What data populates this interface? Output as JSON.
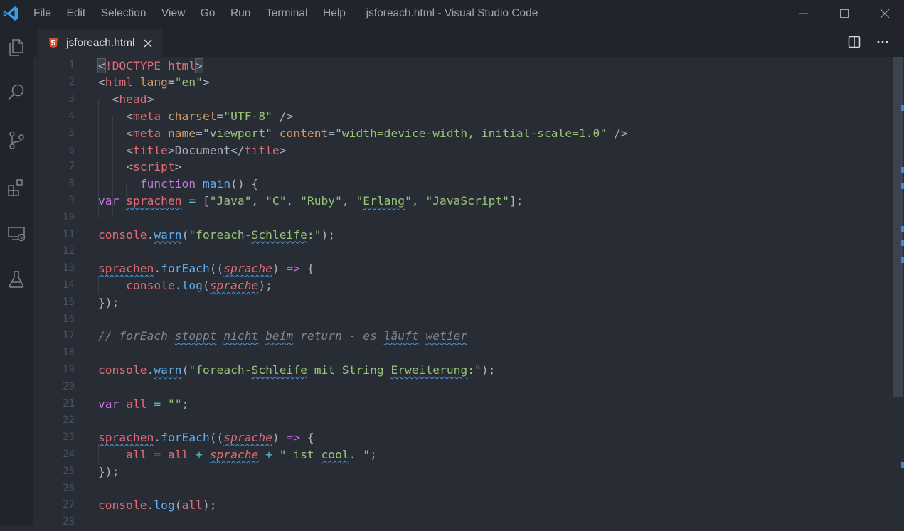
{
  "titlebar": {
    "menu": [
      "File",
      "Edit",
      "Selection",
      "View",
      "Go",
      "Run",
      "Terminal",
      "Help"
    ],
    "window_title": "jsforeach.html - Visual Studio Code"
  },
  "activity_bar": {
    "icons": [
      "explorer-icon",
      "search-icon",
      "source-control-icon",
      "extensions-icon",
      "remote-explorer-icon",
      "testing-icon"
    ]
  },
  "tabs": [
    {
      "label": "jsforeach.html",
      "icon": "html5-icon",
      "active": true
    }
  ],
  "editor": {
    "lines": [
      {
        "n": "1",
        "tokens": [
          [
            "bracket",
            "<"
          ],
          [
            "tag",
            "!DOCTYPE"
          ],
          [
            "plain",
            " "
          ],
          [
            "tag",
            "html"
          ],
          [
            "bracket",
            ">"
          ]
        ]
      },
      {
        "n": "2",
        "tokens": [
          [
            "punc",
            "<"
          ],
          [
            "tag",
            "html"
          ],
          [
            "plain",
            " "
          ],
          [
            "attr",
            "lang"
          ],
          [
            "punc",
            "="
          ],
          [
            "str",
            "\"en\""
          ],
          [
            "punc",
            ">"
          ]
        ]
      },
      {
        "n": "3",
        "tokens": [
          [
            "plain",
            "  "
          ],
          [
            "punc",
            "<"
          ],
          [
            "tag",
            "head"
          ],
          [
            "punc",
            ">"
          ]
        ]
      },
      {
        "n": "4",
        "tokens": [
          [
            "plain",
            "    "
          ],
          [
            "punc",
            "<"
          ],
          [
            "tag",
            "meta"
          ],
          [
            "plain",
            " "
          ],
          [
            "attr",
            "charset"
          ],
          [
            "punc",
            "="
          ],
          [
            "str",
            "\"UTF-8\""
          ],
          [
            "plain",
            " "
          ],
          [
            "punc",
            "/>"
          ]
        ]
      },
      {
        "n": "5",
        "tokens": [
          [
            "plain",
            "    "
          ],
          [
            "punc",
            "<"
          ],
          [
            "tag",
            "meta"
          ],
          [
            "plain",
            " "
          ],
          [
            "attr",
            "name"
          ],
          [
            "punc",
            "="
          ],
          [
            "str",
            "\"viewport\""
          ],
          [
            "plain",
            " "
          ],
          [
            "attr",
            "content"
          ],
          [
            "punc",
            "="
          ],
          [
            "str",
            "\"width=device-width, initial-scale=1.0\""
          ],
          [
            "plain",
            " "
          ],
          [
            "punc",
            "/>"
          ]
        ]
      },
      {
        "n": "6",
        "tokens": [
          [
            "plain",
            "    "
          ],
          [
            "punc",
            "<"
          ],
          [
            "tag",
            "title"
          ],
          [
            "punc",
            ">"
          ],
          [
            "plain",
            "Document"
          ],
          [
            "punc",
            "</"
          ],
          [
            "tag",
            "title"
          ],
          [
            "punc",
            ">"
          ]
        ]
      },
      {
        "n": "7",
        "tokens": [
          [
            "plain",
            "    "
          ],
          [
            "punc",
            "<"
          ],
          [
            "tag",
            "script"
          ],
          [
            "punc",
            ">"
          ]
        ]
      },
      {
        "n": "8",
        "tokens": [
          [
            "plain",
            "      "
          ],
          [
            "kw",
            "function"
          ],
          [
            "plain",
            " "
          ],
          [
            "fn",
            "main"
          ],
          [
            "punc",
            "() {"
          ]
        ]
      },
      {
        "n": "9",
        "tokens": [
          [
            "kw",
            "var"
          ],
          [
            "plain",
            " "
          ],
          [
            "var_sq",
            "sprachen"
          ],
          [
            "plain",
            " "
          ],
          [
            "cyan",
            "="
          ],
          [
            "plain",
            " "
          ],
          [
            "punc",
            "["
          ],
          [
            "str",
            "\"Java\""
          ],
          [
            "punc",
            ", "
          ],
          [
            "str",
            "\"C\""
          ],
          [
            "punc",
            ", "
          ],
          [
            "str",
            "\"Ruby\""
          ],
          [
            "punc",
            ", "
          ],
          [
            "str",
            "\""
          ],
          [
            "str_sq",
            "Erlang"
          ],
          [
            "str",
            "\""
          ],
          [
            "punc",
            ", "
          ],
          [
            "str",
            "\"JavaScript\""
          ],
          [
            "punc",
            "];"
          ]
        ]
      },
      {
        "n": "10",
        "tokens": []
      },
      {
        "n": "11",
        "tokens": [
          [
            "var",
            "console"
          ],
          [
            "punc",
            "."
          ],
          [
            "fn_sq",
            "warn"
          ],
          [
            "punc",
            "("
          ],
          [
            "str",
            "\"foreach-"
          ],
          [
            "str_sq",
            "Schleife"
          ],
          [
            "str",
            ":\""
          ],
          [
            "punc",
            ");"
          ]
        ]
      },
      {
        "n": "12",
        "tokens": []
      },
      {
        "n": "13",
        "tokens": [
          [
            "var_sq",
            "sprachen"
          ],
          [
            "punc",
            "."
          ],
          [
            "fn",
            "forEach"
          ],
          [
            "punc",
            "(("
          ],
          [
            "ital_sq",
            "sprache"
          ],
          [
            "punc",
            ") "
          ],
          [
            "kw",
            "=>"
          ],
          [
            "punc",
            " {"
          ]
        ]
      },
      {
        "n": "14",
        "tokens": [
          [
            "plain",
            "    "
          ],
          [
            "var",
            "console"
          ],
          [
            "punc",
            "."
          ],
          [
            "fn",
            "log"
          ],
          [
            "punc",
            "("
          ],
          [
            "ital_sq",
            "sprache"
          ],
          [
            "punc",
            ");"
          ]
        ]
      },
      {
        "n": "15",
        "tokens": [
          [
            "punc",
            "});"
          ]
        ]
      },
      {
        "n": "16",
        "tokens": []
      },
      {
        "n": "17",
        "tokens": [
          [
            "comment",
            "// forEach "
          ],
          [
            "comment_sq",
            "stoppt"
          ],
          [
            "comment",
            " "
          ],
          [
            "comment_sq",
            "nicht"
          ],
          [
            "comment",
            " "
          ],
          [
            "comment_sq",
            "beim"
          ],
          [
            "comment",
            " return - es "
          ],
          [
            "comment_sq",
            "läuft"
          ],
          [
            "comment",
            " "
          ],
          [
            "comment_sq",
            "wetier"
          ]
        ]
      },
      {
        "n": "18",
        "tokens": []
      },
      {
        "n": "19",
        "tokens": [
          [
            "var",
            "console"
          ],
          [
            "punc",
            "."
          ],
          [
            "fn_sq",
            "warn"
          ],
          [
            "punc",
            "("
          ],
          [
            "str",
            "\"foreach-"
          ],
          [
            "str_sq",
            "Schleife"
          ],
          [
            "str",
            " mit String "
          ],
          [
            "str_sq",
            "Erweiterung"
          ],
          [
            "str",
            ":\""
          ],
          [
            "punc",
            ");"
          ]
        ]
      },
      {
        "n": "20",
        "tokens": []
      },
      {
        "n": "21",
        "tokens": [
          [
            "kw",
            "var"
          ],
          [
            "plain",
            " "
          ],
          [
            "var",
            "all"
          ],
          [
            "plain",
            " "
          ],
          [
            "cyan",
            "="
          ],
          [
            "plain",
            " "
          ],
          [
            "str",
            "\"\""
          ],
          [
            "punc",
            ";"
          ]
        ]
      },
      {
        "n": "22",
        "tokens": []
      },
      {
        "n": "23",
        "tokens": [
          [
            "var_sq",
            "sprachen"
          ],
          [
            "punc",
            "."
          ],
          [
            "fn",
            "forEach"
          ],
          [
            "punc",
            "(("
          ],
          [
            "ital_sq",
            "sprache"
          ],
          [
            "punc",
            ") "
          ],
          [
            "kw",
            "=>"
          ],
          [
            "punc",
            " {"
          ]
        ]
      },
      {
        "n": "24",
        "tokens": [
          [
            "plain",
            "    "
          ],
          [
            "var",
            "all"
          ],
          [
            "plain",
            " "
          ],
          [
            "cyan",
            "="
          ],
          [
            "plain",
            " "
          ],
          [
            "var",
            "all"
          ],
          [
            "plain",
            " "
          ],
          [
            "cyan",
            "+"
          ],
          [
            "plain",
            " "
          ],
          [
            "ital_sq",
            "sprache"
          ],
          [
            "plain",
            " "
          ],
          [
            "cyan",
            "+"
          ],
          [
            "plain",
            " "
          ],
          [
            "str",
            "\" ist "
          ],
          [
            "str_sq",
            "cool"
          ],
          [
            "str",
            ". \""
          ],
          [
            "punc",
            ";"
          ]
        ]
      },
      {
        "n": "25",
        "tokens": [
          [
            "punc",
            "});"
          ]
        ]
      },
      {
        "n": "26",
        "tokens": []
      },
      {
        "n": "27",
        "tokens": [
          [
            "var",
            "console"
          ],
          [
            "punc",
            "."
          ],
          [
            "fn",
            "log"
          ],
          [
            "punc",
            "("
          ],
          [
            "var",
            "all"
          ],
          [
            "punc",
            ");"
          ]
        ]
      },
      {
        "n": "28",
        "tokens": []
      }
    ]
  },
  "colors": {
    "background": "#282c34",
    "chrome": "#21252b",
    "accent": "#3794ff"
  }
}
